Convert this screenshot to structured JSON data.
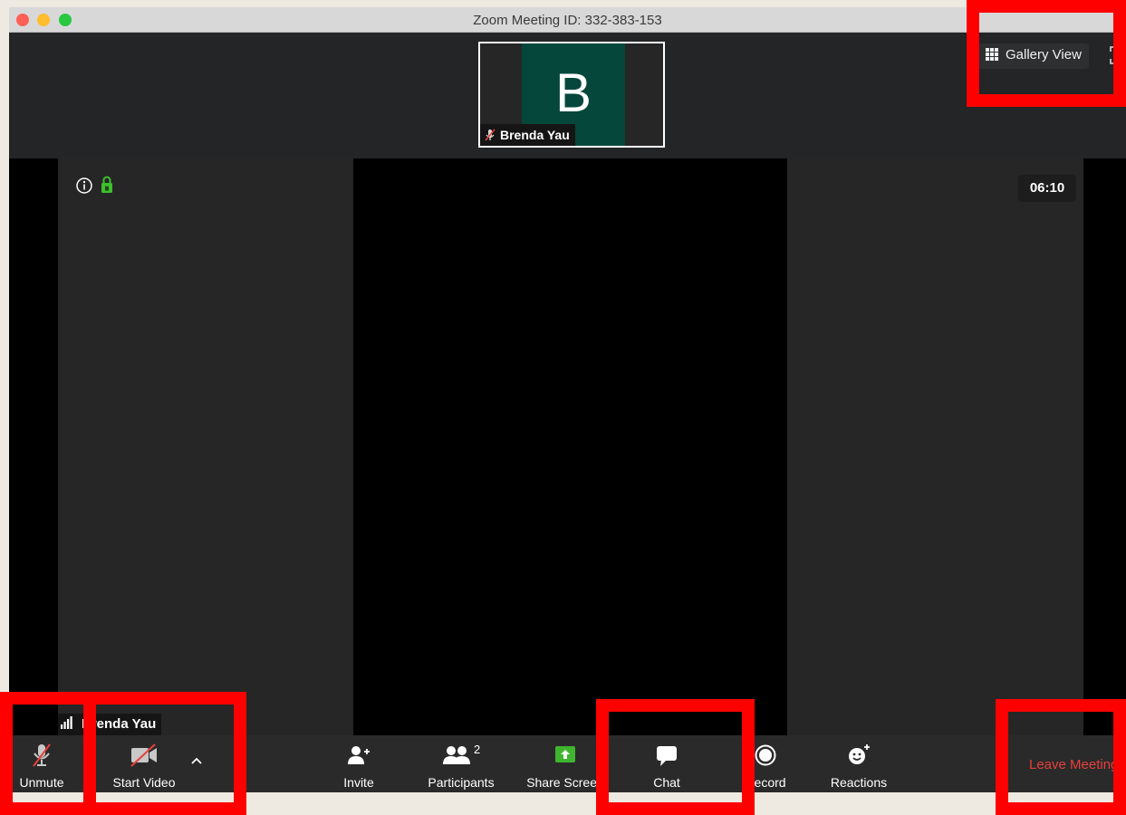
{
  "window": {
    "title": "Zoom Meeting ID: 332-383-153"
  },
  "thumbnail": {
    "initial": "B",
    "name": "Brenda Yau"
  },
  "top_controls": {
    "gallery_label": "Gallery View"
  },
  "video": {
    "timer": "06:10",
    "participant_name": "Brenda Yau"
  },
  "toolbar": {
    "unmute": "Unmute",
    "start_video": "Start Video",
    "invite": "Invite",
    "participants": "Participants",
    "participants_count": "2",
    "share_screen": "Share Screen",
    "chat": "Chat",
    "record": "Record",
    "reactions": "Reactions",
    "leave": "Leave Meeting"
  },
  "colors": {
    "avatar_bg": "#06473c",
    "share_green": "#3fb52f",
    "leave_red": "#e8403b",
    "annotation_red": "#ff0000",
    "encryption_green": "#3fbf2f"
  }
}
